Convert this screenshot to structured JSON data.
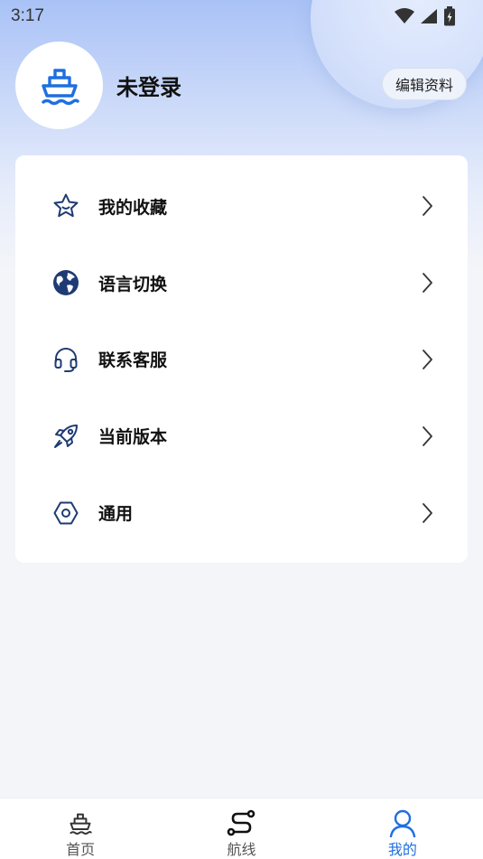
{
  "status_bar": {
    "time": "3:17"
  },
  "profile": {
    "name": "未登录",
    "edit_label": "编辑资料"
  },
  "menu": [
    {
      "label": "我的收藏",
      "icon": "star-icon"
    },
    {
      "label": "语言切换",
      "icon": "globe-icon"
    },
    {
      "label": "联系客服",
      "icon": "headset-icon"
    },
    {
      "label": "当前版本",
      "icon": "rocket-icon"
    },
    {
      "label": "通用",
      "icon": "settings-hexagon-icon"
    }
  ],
  "tabs": [
    {
      "label": "首页",
      "icon": "ship-icon",
      "active": false
    },
    {
      "label": "航线",
      "icon": "route-icon",
      "active": false
    },
    {
      "label": "我的",
      "icon": "user-icon",
      "active": true
    }
  ],
  "colors": {
    "accent": "#1e6fe0",
    "icon_navy": "#1f3b73",
    "header_top": "#a9c2f6",
    "background": "#f4f5f9"
  }
}
